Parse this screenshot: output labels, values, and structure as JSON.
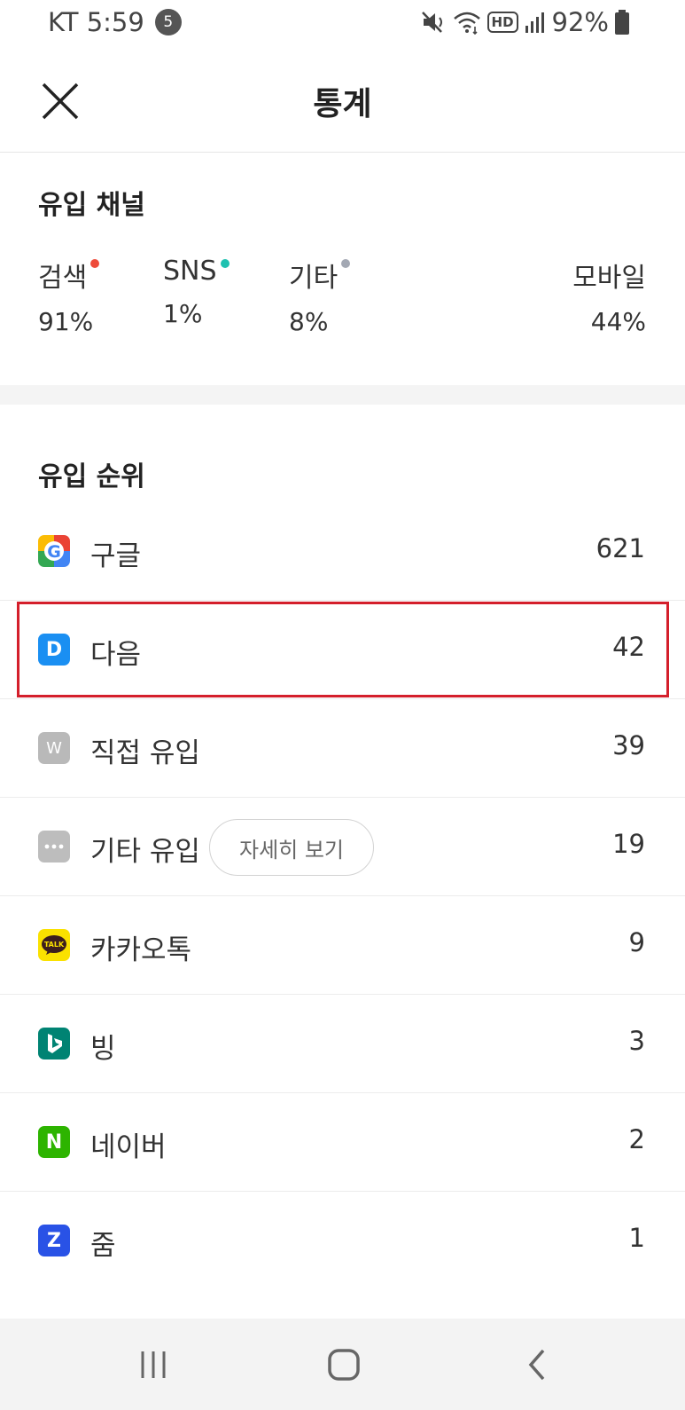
{
  "status_bar": {
    "carrier_time": "KT 5:59",
    "notification_count": "5",
    "network": "HD",
    "battery": "92%"
  },
  "header": {
    "title": "통계",
    "close_icon": "close-icon"
  },
  "inflow_channel": {
    "title": "유입 채널",
    "channels": [
      {
        "label": "검색",
        "value": "91%",
        "dot_color": "#ee4b3a"
      },
      {
        "label": "SNS",
        "value": "1%",
        "dot_color": "#1ec1b0"
      },
      {
        "label": "기타",
        "value": "8%",
        "dot_color": "#a3a8b3"
      }
    ],
    "mobile": {
      "label": "모바일",
      "value": "44%"
    }
  },
  "inflow_rank": {
    "title": "유입 순위",
    "detail_button_label": "자세히 보기",
    "items": [
      {
        "label": "구글",
        "count": "621",
        "icon": "google-icon"
      },
      {
        "label": "다음",
        "count": "42",
        "icon": "daum-icon",
        "icon_letter": "D",
        "highlighted": true
      },
      {
        "label": "직접 유입",
        "count": "39",
        "icon": "direct-inflow-icon",
        "icon_letter": "W"
      },
      {
        "label": "기타 유입",
        "count": "19",
        "icon": "more-dots-icon"
      },
      {
        "label": "카카오톡",
        "count": "9",
        "icon": "kakaotalk-icon",
        "icon_text": "TALK"
      },
      {
        "label": "빙",
        "count": "3",
        "icon": "bing-icon"
      },
      {
        "label": "네이버",
        "count": "2",
        "icon": "naver-icon",
        "icon_letter": "N"
      },
      {
        "label": "줌",
        "count": "1",
        "icon": "zum-icon",
        "icon_letter": "Z"
      }
    ]
  },
  "colors": {
    "highlight_border": "#d41f2b",
    "daum": "#1a8ff2",
    "direct": "#b9b9b9",
    "kakao": "#fae100",
    "bing": "#008373",
    "naver": "#2db400",
    "zum": "#2952e6"
  },
  "nav_bar": {
    "icons": [
      "recent-apps-icon",
      "home-icon",
      "back-icon"
    ]
  }
}
